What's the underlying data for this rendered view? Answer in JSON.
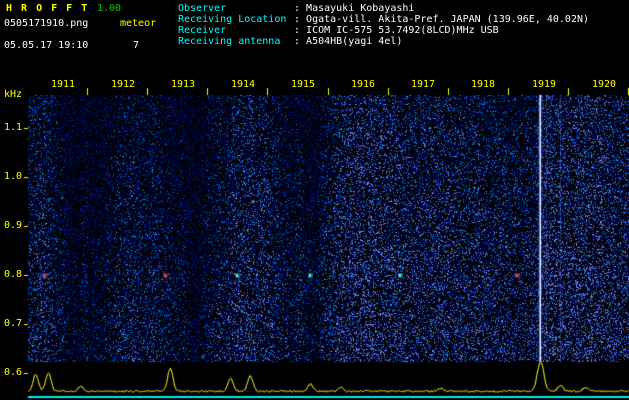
{
  "header": {
    "app_name": "H R O F F T",
    "version": "1.00",
    "filename": "0505171910.png",
    "mode": "meteor",
    "datetime": "05.05.17 19:10",
    "count": "7",
    "info": [
      {
        "label": "Observer",
        "value": "Masayuki Kobayashi"
      },
      {
        "label": "Receiving Location",
        "value": "Ogata-vill. Akita-Pref. JAPAN (139.96E, 40.02N)"
      },
      {
        "label": "Receiver",
        "value": "ICOM IC-575 53.7492(8LCD)MHz USB"
      },
      {
        "label": "Receiving antenna",
        "value": "A504HB(yagi 4el)"
      }
    ]
  },
  "chart_data": {
    "type": "heatmap",
    "subtype": "radio-meteor-echo-spectrogram",
    "time_window": {
      "start": "19:10",
      "end": "19:20"
    },
    "x_axis": {
      "tick_labels": [
        "1911",
        "1912",
        "1913",
        "1914",
        "1915",
        "1916",
        "1917",
        "1918",
        "1919",
        "1920"
      ]
    },
    "y_axis": {
      "label": "kHz",
      "tick_labels": [
        "1.1",
        "1.0",
        "0.9",
        "0.8",
        "0.7",
        "0.6"
      ],
      "range_khz": [
        0.55,
        1.15
      ]
    },
    "carrier_freq_khz": 0.8,
    "echo_events": [
      {
        "time_min": 0.28,
        "freq_khz": 0.8,
        "color": "red",
        "shape": "dot",
        "intensity": "medium"
      },
      {
        "time_min": 2.28,
        "freq_khz": 0.8,
        "color": "red",
        "shape": "dot",
        "intensity": "medium"
      },
      {
        "time_min": 3.48,
        "freq_khz": 0.8,
        "color": "cyan",
        "shape": "dot",
        "intensity": "weak"
      },
      {
        "time_min": 4.69,
        "freq_khz": 0.8,
        "color": "cyan",
        "shape": "dot",
        "intensity": "weak"
      },
      {
        "time_min": 6.19,
        "freq_khz": 0.8,
        "color": "cyan",
        "shape": "dot",
        "intensity": "weak"
      },
      {
        "time_min": 8.14,
        "freq_khz": 0.8,
        "color": "red",
        "shape": "dot",
        "intensity": "medium"
      },
      {
        "time_min": 8.52,
        "freq_khz": 0.8,
        "color": "white",
        "shape": "column",
        "intensity": "strong"
      },
      {
        "time_min": 8.62,
        "freq_khz": 0.8,
        "color": "blue",
        "shape": "column-faint",
        "intensity": "weak"
      },
      {
        "time_min": 8.85,
        "freq_khz": 0.8,
        "color": "blue",
        "shape": "column-faint",
        "intensity": "weak"
      }
    ],
    "amplitude_series": {
      "baseline_level": 0.05,
      "peaks": [
        {
          "time_min": 0.12,
          "level": 0.57
        },
        {
          "time_min": 0.33,
          "level": 0.63
        },
        {
          "time_min": 0.87,
          "level": 0.17
        },
        {
          "time_min": 2.36,
          "level": 0.77
        },
        {
          "time_min": 3.36,
          "level": 0.43
        },
        {
          "time_min": 3.69,
          "level": 0.5
        },
        {
          "time_min": 4.69,
          "level": 0.23
        },
        {
          "time_min": 5.19,
          "level": 0.13
        },
        {
          "time_min": 6.86,
          "level": 0.1
        },
        {
          "time_min": 8.52,
          "level": 1.0,
          "width": 3.2
        },
        {
          "time_min": 8.85,
          "level": 0.2
        },
        {
          "time_min": 9.27,
          "level": 0.13
        }
      ]
    }
  },
  "colors": {
    "background": "#000000",
    "title_yellow": "#ffff00",
    "version_green": "#00cc00",
    "label_cyan": "#00ffff",
    "value_white": "#ffffff",
    "axis_yellow": "#ffff00",
    "noise_blue": "#2040ff",
    "echo_red": "#ff4040",
    "echo_cyan": "#40ffff",
    "echo_white": "#e8f2ff",
    "echo_blue": "#6080ff",
    "trace_yellow": "#ffff33",
    "baseline_cyan": "#00eeee"
  }
}
